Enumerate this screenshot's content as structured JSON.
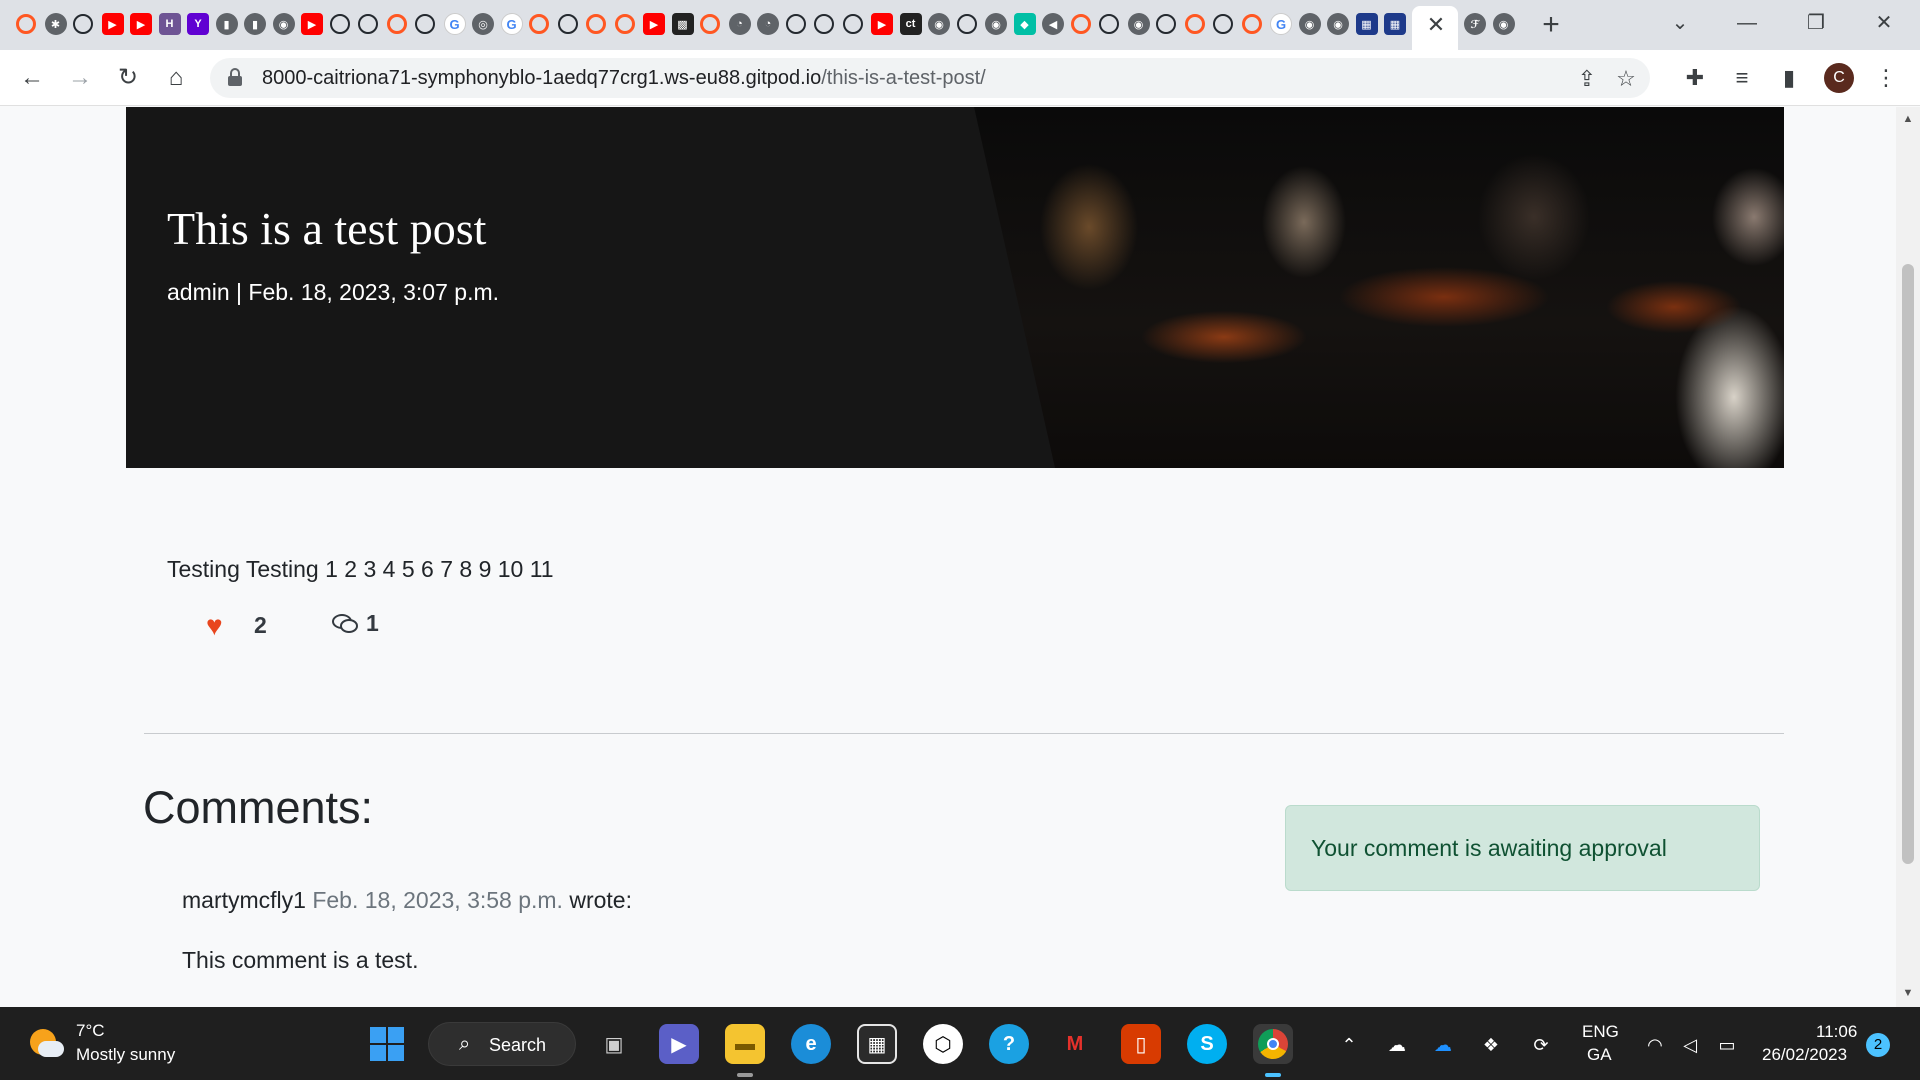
{
  "browser": {
    "tabs": {
      "active_close_label": "✕",
      "new_tab_label": "+",
      "favicons": [
        "O",
        "✱",
        "GH",
        "▶",
        "▶",
        "H",
        "Y",
        "▮",
        "▮",
        "◉",
        "▶",
        "GH",
        "GH",
        "O",
        "GH",
        "G",
        "◎",
        "G",
        "O",
        "GH",
        "O",
        "O",
        "▶",
        "▩",
        "O",
        "◔",
        "◔",
        "GH",
        "GH",
        "GH",
        "▶",
        "ct",
        "◉",
        "GH",
        "◉",
        "◆",
        "◀",
        "O",
        "GH",
        "◉",
        "GH",
        "O",
        "GH",
        "O",
        "G",
        "◉",
        "◉",
        "▦",
        "▦",
        "G",
        "ℱ",
        "◉"
      ]
    },
    "window_controls": {
      "list": "⌄",
      "minimize": "—",
      "maximize": "❐",
      "close": "✕"
    },
    "url": {
      "host": "8000-caitriona71-symphonyblo-1aedq77crg1.ws-eu88.gitpod.io",
      "path": "/this-is-a-test-post/"
    },
    "profile_initial": "C"
  },
  "post": {
    "title": "This is a test post",
    "meta": "admin | Feb. 18, 2023, 3:07 p.m.",
    "body": "Testing Testing 1 2 3 4 5 6 7 8 9 10 11",
    "like_count": "2",
    "comment_count": "1"
  },
  "comments": {
    "heading": "Comments:",
    "alert": "Your comment is awaiting approval",
    "items": [
      {
        "author": "martymcfly1",
        "date": "Feb. 18, 2023, 3:58 p.m.",
        "suffix": "wrote:",
        "text": "This comment is a test."
      }
    ]
  },
  "taskbar": {
    "weather_temp": "7°C",
    "weather_desc": "Mostly sunny",
    "search_label": "Search",
    "lang_top": "ENG",
    "lang_bottom": "GA",
    "time": "11:06",
    "date": "26/02/2023",
    "notification_count": "2"
  }
}
